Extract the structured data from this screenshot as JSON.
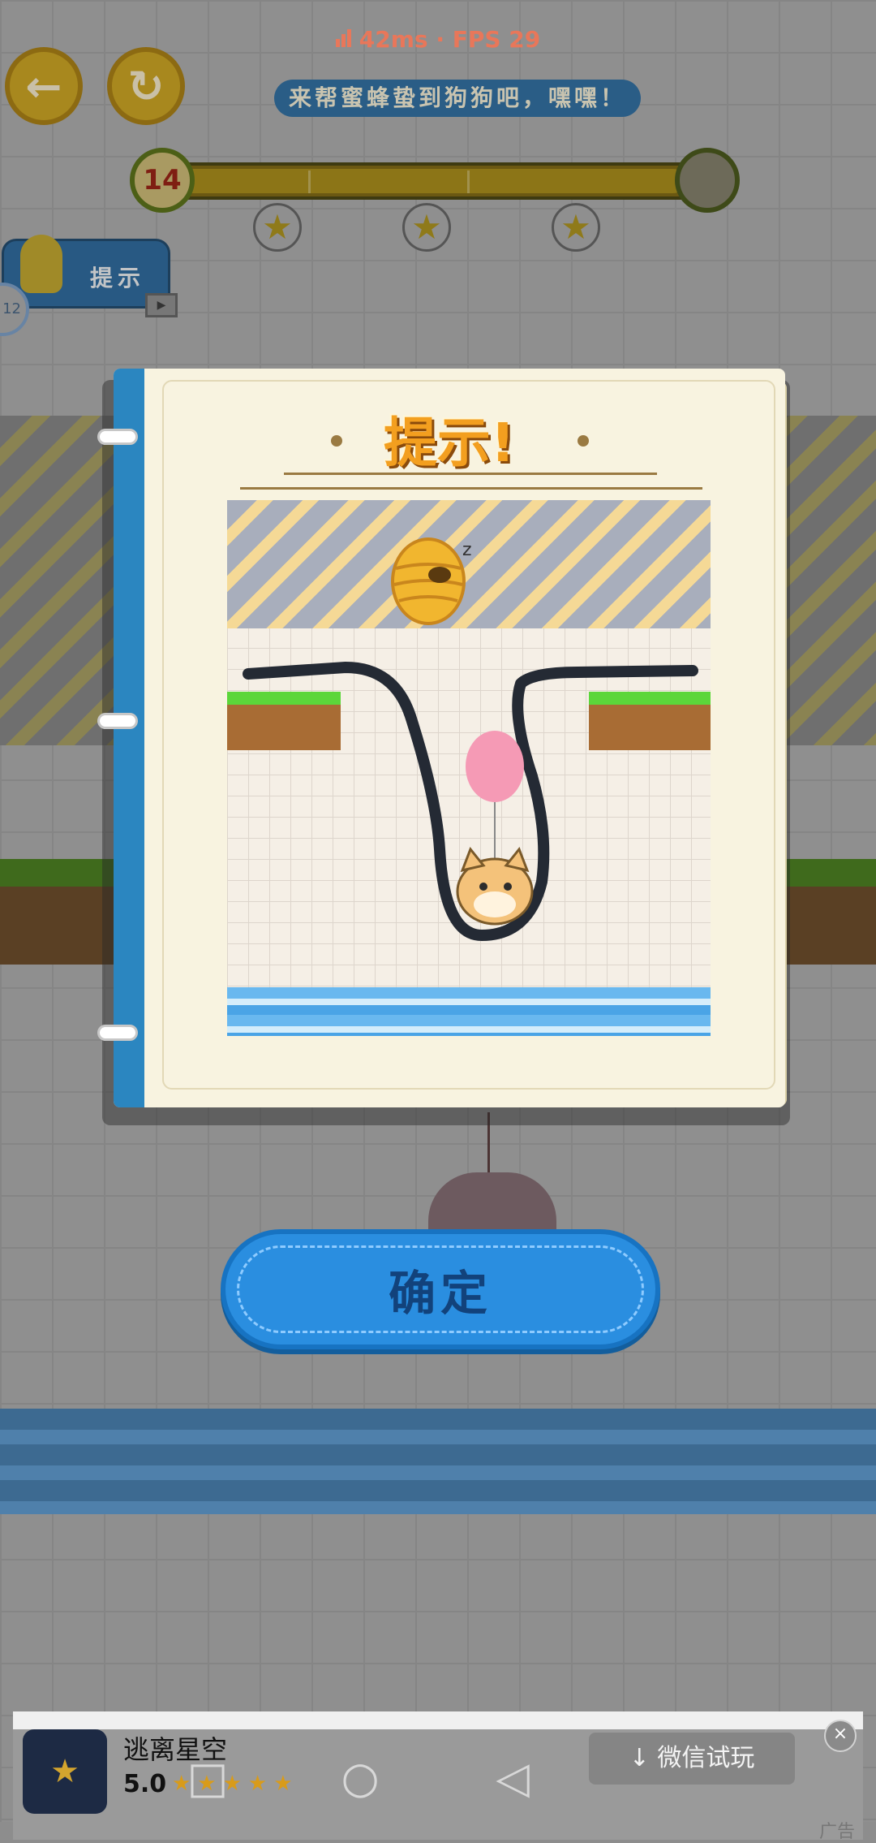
{
  "network": {
    "ping": "42ms",
    "fps": "FPS 29",
    "separator": "·"
  },
  "hud": {
    "back_icon": "back-arrow-icon",
    "restart_icon": "restart-icon",
    "objective": "来帮蜜蜂蛰到狗狗吧，嘿嘿！",
    "level": "14",
    "stars": [
      "★",
      "★",
      "★"
    ],
    "hint_button": "提示",
    "badge": "12"
  },
  "dialog": {
    "title": "提示!",
    "confirm": "确定"
  },
  "ad": {
    "app_name": "逃离星空",
    "rating": "5.0",
    "stars": "★★★★★",
    "cta": "微信试玩",
    "label": "广告",
    "close": "×"
  },
  "nav": {
    "home": "□",
    "circle": "○",
    "back": "◁"
  },
  "colors": {
    "accent": "#2a8ee0",
    "title": "#f39f1f",
    "ping": "#e8775a"
  }
}
